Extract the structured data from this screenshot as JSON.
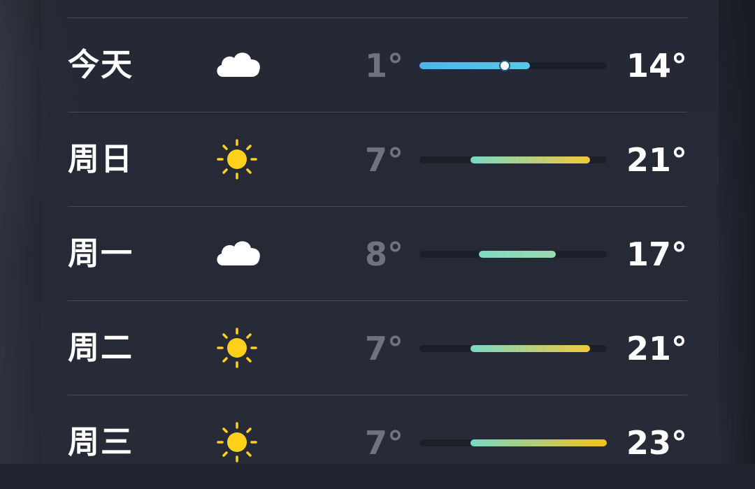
{
  "forecast": {
    "range_min": 1,
    "range_max": 23,
    "days": [
      {
        "day": "今天",
        "icon": "cloud-icon",
        "low": "1°",
        "high": "14°",
        "low_value": 1,
        "high_value": 14,
        "current_value": 11,
        "colors": [
          "#4fb3ea",
          "#59c7ea"
        ]
      },
      {
        "day": "周日",
        "icon": "sun-icon",
        "low": "7°",
        "high": "21°",
        "low_value": 7,
        "high_value": 21,
        "colors": [
          "#78d8c4",
          "#f2c83c"
        ]
      },
      {
        "day": "周一",
        "icon": "cloud-icon",
        "low": "8°",
        "high": "17°",
        "low_value": 8,
        "high_value": 17,
        "colors": [
          "#80d9c2",
          "#9adbb0"
        ]
      },
      {
        "day": "周二",
        "icon": "sun-icon",
        "low": "7°",
        "high": "21°",
        "low_value": 7,
        "high_value": 21,
        "colors": [
          "#78d8c4",
          "#f2c83c"
        ]
      },
      {
        "day": "周三",
        "icon": "sun-icon",
        "low": "7°",
        "high": "23°",
        "low_value": 7,
        "high_value": 23,
        "colors": [
          "#78d8c4",
          "#f6c21c"
        ]
      }
    ]
  },
  "colors": {
    "sun": "#ffd11a",
    "cloud": "#ffffff",
    "low_text": "#6f7380",
    "high_text": "#ffffff"
  }
}
